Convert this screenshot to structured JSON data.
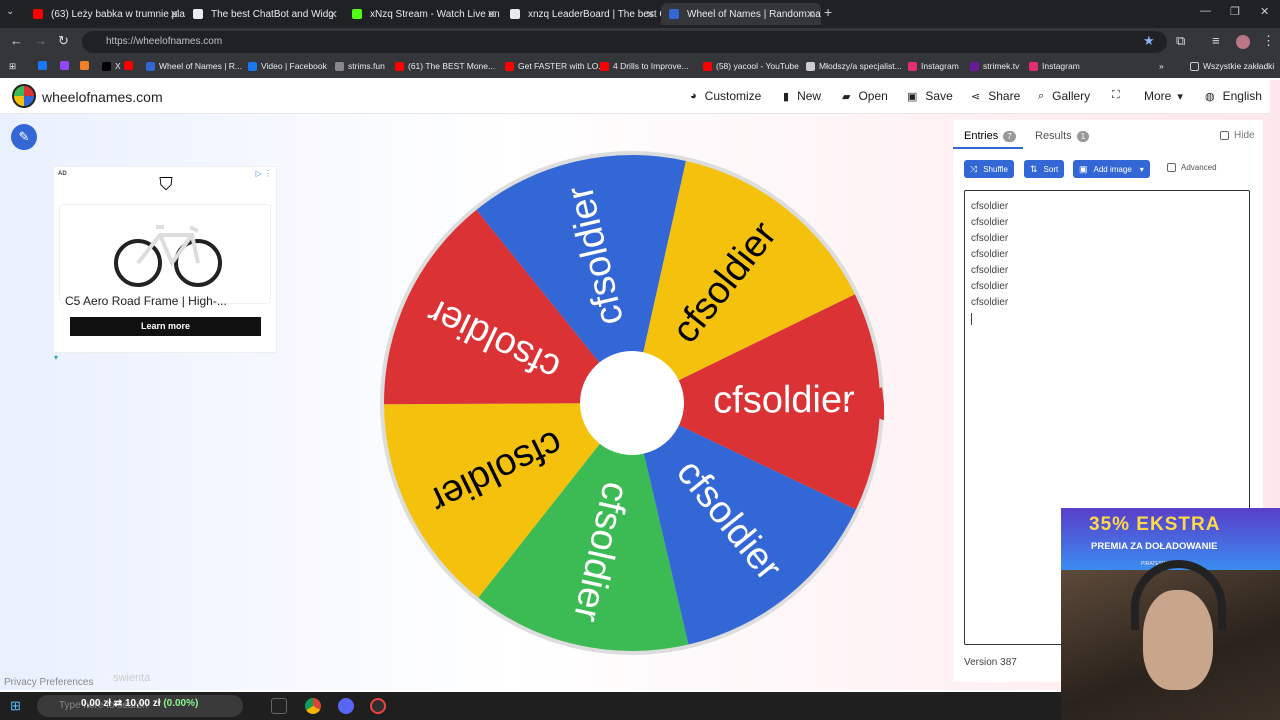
{
  "browser": {
    "tabs": [
      {
        "label": "(63) Leży babka w trumnie plac",
        "color": "#ff0000"
      },
      {
        "label": "The best ChatBot and Widg",
        "color": "#e8eaed"
      },
      {
        "label": "xNzq Stream - Watch Live on K",
        "color": "#53fc18"
      },
      {
        "label": "xnzq LeaderBoard | The best Ch",
        "color": "#e8eaed"
      },
      {
        "label": "Wheel of Names | Random nam",
        "color": "#3367d6"
      }
    ],
    "url": "https://wheelofnames.com",
    "bookmarks": [
      {
        "label": "",
        "color": "#1877f2"
      },
      {
        "label": "",
        "color": "#9146ff"
      },
      {
        "label": "",
        "color": "#f48024"
      },
      {
        "label": "X",
        "color": "#000000"
      },
      {
        "label": "",
        "color": "#ff0000"
      },
      {
        "label": "Wheel of Names | R...",
        "color": "#3367d6"
      },
      {
        "label": "Video | Facebook",
        "color": "#1877f2"
      },
      {
        "label": "strims.fun",
        "color": "#888888"
      },
      {
        "label": "(61) The BEST Mone...",
        "color": "#ff0000"
      },
      {
        "label": "Get FASTER with LO...",
        "color": "#ff0000"
      },
      {
        "label": "4 Drills to Improve...",
        "color": "#ff0000"
      },
      {
        "label": "(58) yacool - YouTube",
        "color": "#ff0000"
      },
      {
        "label": "Młodszy/a specjalist...",
        "color": "#cccccc"
      },
      {
        "label": "Instagram",
        "color": "#e1306c"
      },
      {
        "label": "strimek.tv",
        "color": "#6a1b9a"
      },
      {
        "label": "Instagram",
        "color": "#e1306c"
      }
    ],
    "all_bookmarks": "Wszystkie zakładki"
  },
  "header": {
    "brand": "wheelofnames.com",
    "menu": [
      {
        "label": "Customize",
        "icon": "palette-icon"
      },
      {
        "label": "New",
        "icon": "file-icon"
      },
      {
        "label": "Open",
        "icon": "folder-icon"
      },
      {
        "label": "Save",
        "icon": "save-icon"
      },
      {
        "label": "Share",
        "icon": "share-icon"
      },
      {
        "label": "Gallery",
        "icon": "search-icon"
      },
      {
        "label": "",
        "icon": "fullscreen-icon"
      },
      {
        "label": "More",
        "icon": "chevron-down-icon"
      },
      {
        "label": "English",
        "icon": "globe-icon"
      }
    ]
  },
  "ad": {
    "tag": "AD",
    "title": "C5 Aero Road Frame | High-...",
    "cta": "Learn more"
  },
  "wheel": {
    "slices": [
      {
        "label": "cfsoldier",
        "color": "#db3236"
      },
      {
        "label": "cfsoldier",
        "color": "#3367d6"
      },
      {
        "label": "cfsoldier",
        "color": "#3cba54"
      },
      {
        "label": "cfsoldier",
        "color": "#f4c20d"
      },
      {
        "label": "cfsoldier",
        "color": "#db3236"
      },
      {
        "label": "cfsoldier",
        "color": "#3367d6"
      },
      {
        "label": "cfsoldier",
        "color": "#f4c20d"
      }
    ],
    "pointer_color": "#db3236"
  },
  "panel": {
    "tabs": [
      {
        "label": "Entries",
        "count": "7"
      },
      {
        "label": "Results",
        "count": "1"
      }
    ],
    "hide_label": "Hide",
    "buttons": {
      "shuffle": "Shuffle",
      "sort": "Sort",
      "add_image": "Add image"
    },
    "advanced_label": "Advanced",
    "entries": [
      "cfsoldier",
      "cfsoldier",
      "cfsoldier",
      "cfsoldier",
      "cfsoldier",
      "cfsoldier",
      "cfsoldier"
    ],
    "version": "Version 387"
  },
  "footer": {
    "privacy": "Privacy Preferences",
    "overlay_name": "swienta"
  },
  "promo": {
    "big": "35% EKSTRA",
    "sub": "PREMIA ZA DOŁADOWANIE",
    "domain": "PIRATESWAP.COM"
  },
  "taskbar": {
    "search_placeholder": "Type here to search",
    "money": "0,00 zł ⇄ 10,00 zł",
    "percent": "(0.00%)"
  }
}
